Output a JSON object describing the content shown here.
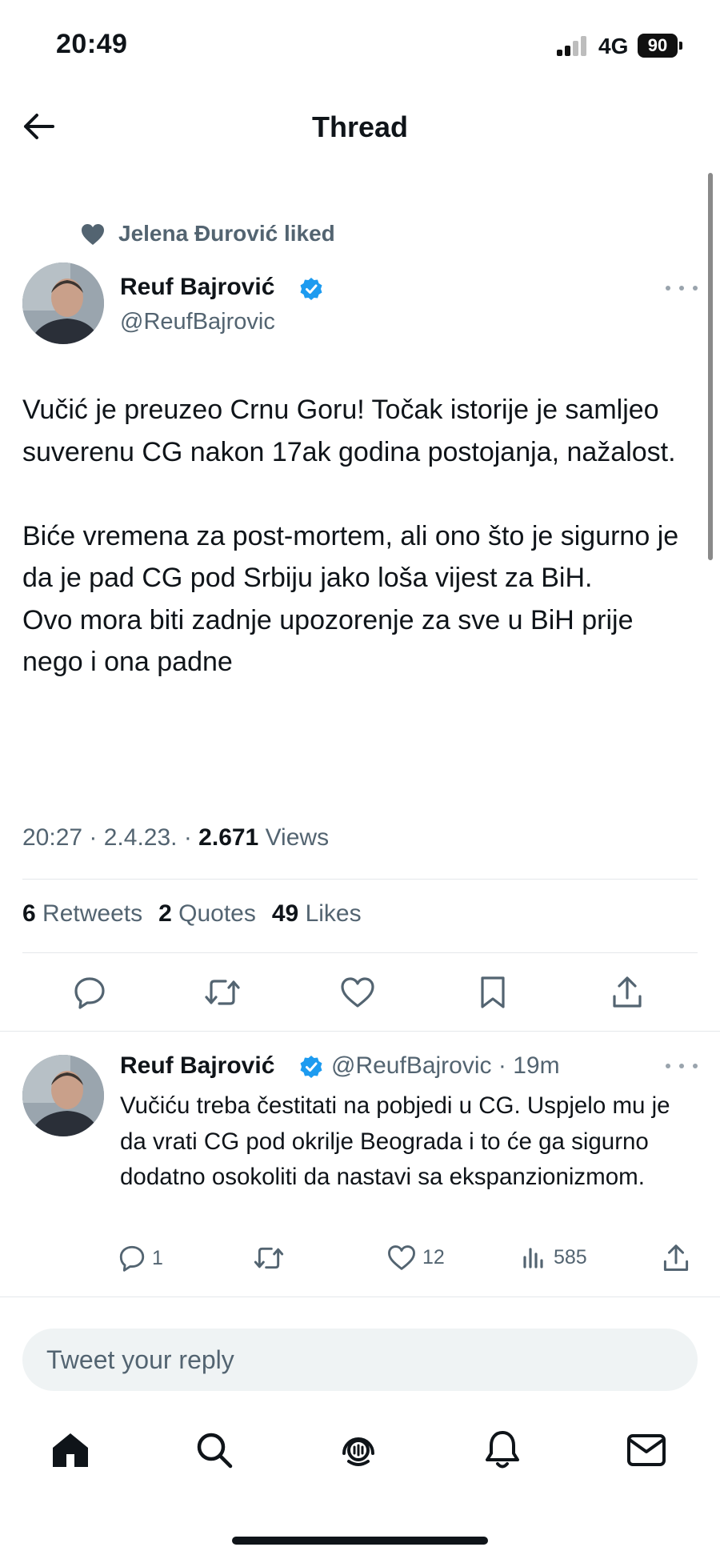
{
  "status_bar": {
    "time": "20:49",
    "network": "4G",
    "battery": "90"
  },
  "header": {
    "title": "Thread"
  },
  "social_context": {
    "text": "Jelena Đurović liked"
  },
  "tweet": {
    "author_name": "Reuf Bajrović",
    "author_handle": "@ReufBajrovic",
    "text": "Vučić je preuzeo Crnu Goru! Točak istorije je samljeo suverenu CG nakon 17ak godina postojanja, nažalost.\n\nBiće vremena za post-mortem, ali ono što je sigurno je da je pad CG pod Srbiju jako loša vijest za BiH.\nOvo mora biti zadnje upozorenje za sve u BiH prije nego i ona padne",
    "time": "20:27",
    "date": "2.4.23.",
    "views_count": "2.671",
    "views_label": "Views",
    "retweets_count": "6",
    "retweets_label": "Retweets",
    "quotes_count": "2",
    "quotes_label": "Quotes",
    "likes_count": "49",
    "likes_label": "Likes"
  },
  "reply": {
    "author_name": "Reuf Bajrović",
    "author_handle": "@ReufBajrovic",
    "time_ago": "19m",
    "text": "Vučiću treba čestitati na pobjedi u CG. Uspjelo mu je da vrati CG pod okrilje Beograda i to će ga sigurno dodatno osokoliti da nastavi sa ekspanzionizmom.",
    "reply_count": "1",
    "like_count": "12",
    "view_count": "585"
  },
  "composer": {
    "placeholder": "Tweet your reply"
  },
  "colors": {
    "text": "#0f1419",
    "secondary": "#536471",
    "verified": "#1d9bf0",
    "divider": "#e4e8eb",
    "input_bg": "#eff3f4"
  },
  "icons": [
    "back-arrow-icon",
    "heart-icon",
    "verified-badge-icon",
    "more-icon",
    "reply-icon",
    "retweet-icon",
    "like-icon",
    "bookmark-icon",
    "share-icon",
    "views-icon",
    "home-icon",
    "search-icon",
    "spaces-icon",
    "notifications-icon",
    "messages-icon"
  ]
}
